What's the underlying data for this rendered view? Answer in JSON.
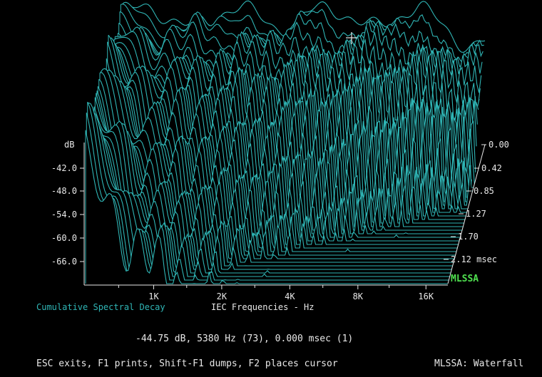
{
  "chart_data": {
    "type": "waterfall",
    "title": "Cumulative Spectral Decay",
    "xlabel": "IEC Frequencies - Hz",
    "ylabel": "dB",
    "x_ticks": [
      "1K",
      "2K",
      "4K",
      "8K",
      "16K"
    ],
    "y_ticks": [
      "-42.0",
      "-48.0",
      "-54.0",
      "-60.0",
      "-66.0"
    ],
    "time_ticks": [
      "0.00",
      "0.42",
      "0.85",
      "1.27",
      "1.70",
      "2.12 msec"
    ],
    "x_scale": "log",
    "xlim_hz": [
      500,
      20000
    ],
    "ylim_db": [
      -72,
      -36
    ],
    "tlim_ms": [
      0,
      2.5
    ],
    "line_color": "#2fb5b5",
    "cursor": {
      "level_db": -44.75,
      "freq_hz": 5380,
      "bin": 73,
      "time_ms": 0.0,
      "slice": 1
    }
  },
  "status": {
    "cursor_readout": "-44.75 dB, 5380 Hz (73), 0.000 msec (1)",
    "help": "ESC exits, F1 prints, Shift-F1 dumps, F2 places cursor",
    "mode": "MLSSA: Waterfall",
    "brand": "MLSSA"
  }
}
